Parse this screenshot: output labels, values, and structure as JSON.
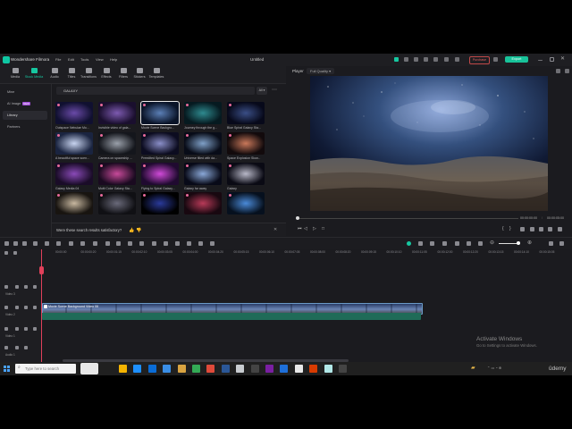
{
  "app": {
    "name": "Wondershare Filmora",
    "menu": [
      "File",
      "Edit",
      "Tools",
      "View",
      "Help"
    ],
    "project_title": "Untitled",
    "purchase_label": "Purchase",
    "export_label": "Export"
  },
  "toolbar": {
    "tabs": [
      {
        "label": "Media",
        "icon": "media-icon"
      },
      {
        "label": "Stock Media",
        "icon": "stock-media-icon",
        "active": true
      },
      {
        "label": "Audio",
        "icon": "music-note-icon"
      },
      {
        "label": "Titles",
        "icon": "text-icon"
      },
      {
        "label": "Transitions",
        "icon": "transition-icon"
      },
      {
        "label": "Effects",
        "icon": "sparkle-icon"
      },
      {
        "label": "Filters",
        "icon": "filter-icon"
      },
      {
        "label": "Stickers",
        "icon": "sticker-icon"
      },
      {
        "label": "Templates",
        "icon": "template-icon"
      }
    ]
  },
  "sidebar": {
    "items": [
      {
        "label": "Mine",
        "selected": false
      },
      {
        "label": "AI Image",
        "badge": "NEW",
        "selected": false
      },
      {
        "label": "Library",
        "selected": true
      },
      {
        "label": "Partners",
        "selected": false
      }
    ]
  },
  "library": {
    "search_value": "GALAXY",
    "filter_label": "All",
    "items": [
      {
        "label": "Outspace Nebulae Mo...",
        "c1": "#6a4aa8",
        "c2": "#101030"
      },
      {
        "label": "Invisible video of gala...",
        "c1": "#7d5ab0",
        "c2": "#1a0f2e"
      },
      {
        "label": "Movie Scene Backgro...",
        "c1": "#5b7fb6",
        "c2": "#0a1428",
        "selected": true
      },
      {
        "label": "Journey through the g...",
        "c1": "#2e8a8f",
        "c2": "#061a20"
      },
      {
        "label": "Blue Spiral Galaxy Sta...",
        "c1": "#3a4e86",
        "c2": "#07091a"
      },
      {
        "label": "A beautiful space scen...",
        "c1": "#c8d4f0",
        "c2": "#1a2440"
      },
      {
        "label": "Camera on spaceship ...",
        "c1": "#9aa0aa",
        "c2": "#14161c"
      },
      {
        "label": "Preedited Spiral Galaxy...",
        "c1": "#8a8ec8",
        "c2": "#0c0c20"
      },
      {
        "label": "Universe filled with da...",
        "c1": "#7fa0c8",
        "c2": "#080c18"
      },
      {
        "label": "Space Explosion Slow...",
        "c1": "#c9785a",
        "c2": "#120a0c"
      },
      {
        "label": "Galaxy Media 04",
        "c1": "#8a4ab8",
        "c2": "#1a0c28"
      },
      {
        "label": "Multi Color Galaxy Sta...",
        "c1": "#c84a9a",
        "c2": "#1a0a20"
      },
      {
        "label": "Flying to Spiral Galaxy...",
        "c1": "#d04ad8",
        "c2": "#200a30"
      },
      {
        "label": "Galaxy far away",
        "c1": "#8aa8d8",
        "c2": "#080a18"
      },
      {
        "label": "Galaxy",
        "c1": "#b8b8c8",
        "c2": "#0a0a14"
      },
      {
        "label": "",
        "c1": "#c8b8a0",
        "c2": "#181410"
      },
      {
        "label": "",
        "c1": "#6a6a7a",
        "c2": "#101014"
      },
      {
        "label": "",
        "c1": "#2a3a9a",
        "c2": "#000000"
      },
      {
        "label": "",
        "c1": "#b83a58",
        "c2": "#180810"
      },
      {
        "label": "",
        "c1": "#4a8ad8",
        "c2": "#06101e"
      }
    ],
    "feedback_question": "Were these search results satisfactory?"
  },
  "player": {
    "label": "Player",
    "quality": "Full Quality",
    "time_current": "00:00:00:00",
    "time_total": "00:00:05:00",
    "progress": 0.0
  },
  "timeline": {
    "ruler_ticks": [
      "00:00:00",
      "00:00:00:20",
      "00:00:01:15",
      "00:00:02:10",
      "00:00:03:05",
      "00:00:04:00",
      "00:00:04:20",
      "00:00:05:15",
      "00:00:06:10",
      "00:00:07:05",
      "00:00:08:00",
      "00:00:08:20",
      "00:00:09:15",
      "00:00:10:10",
      "00:00:11:05",
      "00:00:12:00",
      "00:00:12:20",
      "00:00:13:15",
      "00:00:14:10",
      "00:00:15:05"
    ],
    "tracks": [
      "Video 3",
      "Video 2",
      "Video 1",
      "Audio 1"
    ],
    "clip_name": "Movie Scene Background Video 06"
  },
  "watermark": {
    "title": "Activate Windows",
    "subtitle": "Go to Settings to activate Windows."
  },
  "taskbar": {
    "search_placeholder": "Type here to search",
    "apps": [
      "#f5b400",
      "#1e90ff",
      "#0a6cd6",
      "#3a8ee6",
      "#d9a441",
      "#33aa55",
      "#e04a3a",
      "#2b5797",
      "#c8ccd0",
      "#444",
      "#7a1fa2",
      "#1e6fd9",
      "#e8e8e8",
      "#d83b01",
      "#b2e8e8",
      "#444"
    ],
    "udemy_label": "ûdemy"
  },
  "colors": {
    "accent": "#16c7a0",
    "purchase": "#e06060",
    "playhead": "#e0405a"
  }
}
